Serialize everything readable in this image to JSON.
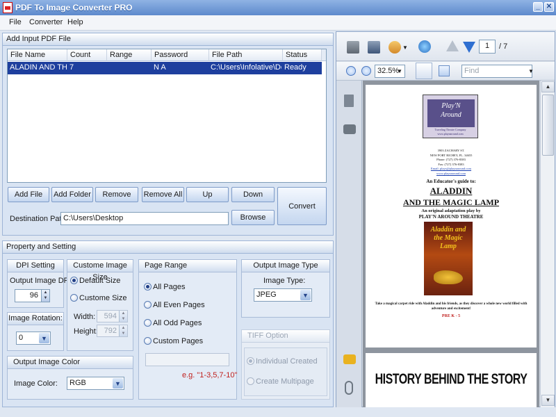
{
  "window": {
    "title": "PDF To Image Converter PRO"
  },
  "menu": [
    "File",
    "Converter",
    "Help"
  ],
  "input_panel": {
    "header": "Add Input PDF File",
    "columns": [
      "File Name",
      "Count",
      "Range",
      "Password",
      "File Path",
      "Status"
    ],
    "rows": [
      {
        "file_name": "ALADIN AND TH...",
        "count": "7",
        "range": "",
        "password": "N A",
        "file_path": "C:\\Users\\Infolative\\De...",
        "status": "Ready"
      }
    ],
    "buttons": {
      "add_file": "Add File",
      "add_folder": "Add Folder",
      "remove": "Remove",
      "remove_all": "Remove All",
      "up": "Up",
      "down": "Down",
      "convert": "Convert",
      "browse": "Browse"
    },
    "destination_label": "Destination Path:",
    "destination_value": "C:\\Users\\Desktop"
  },
  "settings": {
    "header": "Property and Setting",
    "dpi": {
      "title": "DPI Setting",
      "label": "Output Image DPI:",
      "value": "96"
    },
    "rotation": {
      "title": "Image Rotation:",
      "value": "0"
    },
    "custom_size": {
      "title": "Custome Image Size",
      "default_label": "Default Size",
      "custom_label": "Custome Size",
      "width_label": "Width:",
      "width_value": "594",
      "height_label": "Height:",
      "height_value": "792",
      "selected": "default"
    },
    "page_range": {
      "title": "Page Range",
      "options": [
        "All Pages",
        "All Even Pages",
        "All Odd Pages",
        "Custom Pages"
      ],
      "selected": 0,
      "hint": "e.g. \"1-3,5,7-10\"",
      "custom_value": ""
    },
    "output_type": {
      "title": "Output Image Type",
      "label": "Image Type:",
      "value": "JPEG"
    },
    "tiff": {
      "title": "TIFF Option",
      "individual": "Individual Created",
      "multipage": "Create Multipage"
    },
    "color": {
      "title": "Output Image Color",
      "label": "Image Color:",
      "value": "RGB"
    }
  },
  "viewer": {
    "page_current": "1",
    "page_total": "/ 7",
    "zoom": "32.5%",
    "find_placeholder": "Find",
    "doc": {
      "logo_line1": "Play'N",
      "logo_line2": "Around",
      "logo_sub": "Traveling Theatre Company",
      "logo_url": "www.playnaround.com",
      "address": [
        "3903 ZACHARY ST.",
        "NEW PORT RICHEY, FL. 34655",
        "Phone: (727) 376-8383",
        "Fax: (727) 376-8383",
        "Email: plays@playnaround.com",
        "www.playnaround.com"
      ],
      "guide": "An Educator's guide to:",
      "title1": "ALADDIN",
      "title2": "AND THE MAGIC LAMP",
      "adaptation": "An original adaptation play by",
      "theatre": "PLAY'N AROUND THEATRE",
      "poster_text": "Aladdin and the Magic Lamp",
      "blurb": "Take a magical carpet ride with Aladdin and his friends, as they discover a whole new world filled with adventure and excitement!",
      "grades": "PRE K - 5",
      "page2_heading": "HISTORY BEHIND THE STORY"
    }
  }
}
